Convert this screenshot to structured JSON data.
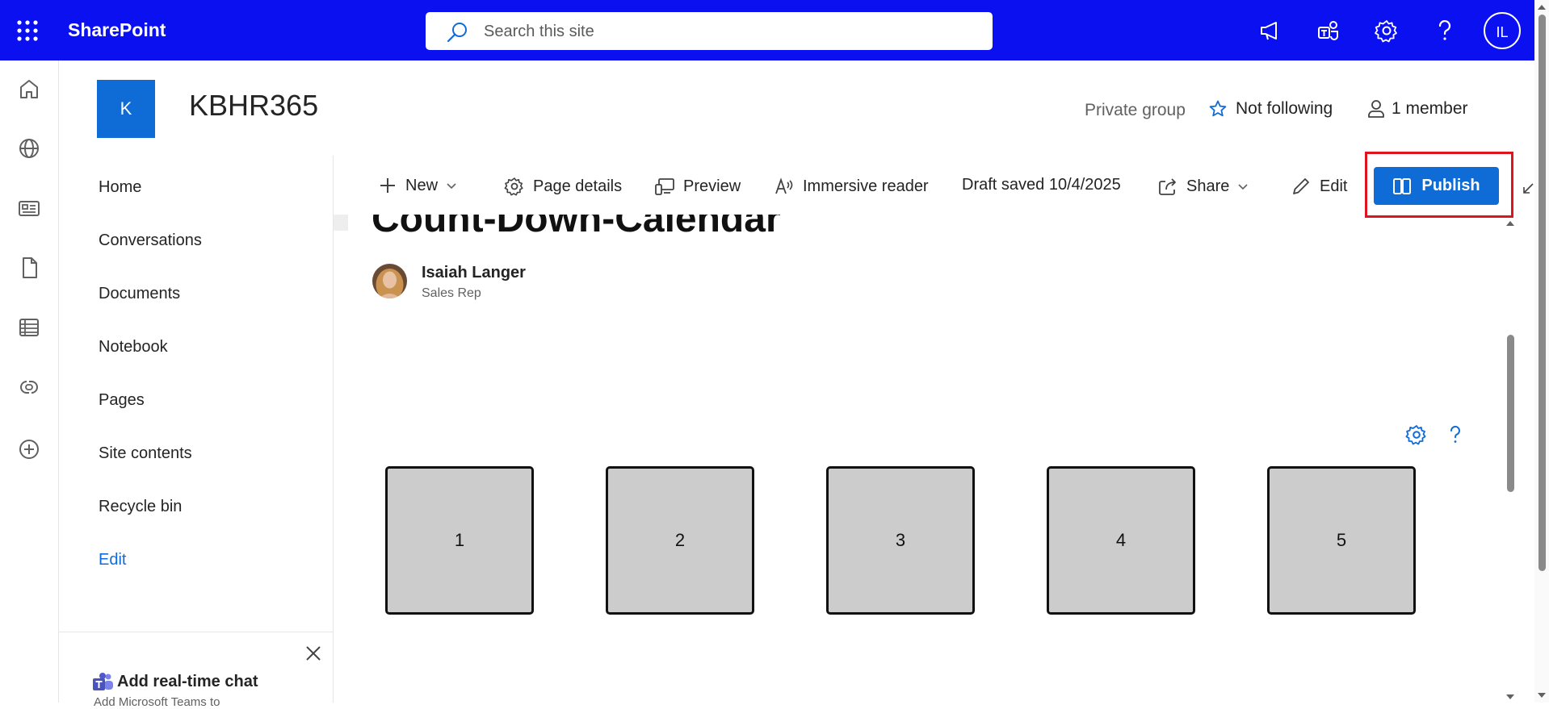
{
  "suite": {
    "brand": "SharePoint",
    "search_placeholder": "Search this site",
    "avatar_initials": "IL",
    "colors": {
      "bar": "#0a10f0",
      "accent": "#0f6cd6",
      "highlight": "#e0141e"
    }
  },
  "site": {
    "logo_letter": "K",
    "title": "KBHR365",
    "privacy": "Private group",
    "follow_label": "Not following",
    "members_label": "1 member"
  },
  "nav": {
    "items": [
      "Home",
      "Conversations",
      "Documents",
      "Notebook",
      "Pages",
      "Site contents",
      "Recycle bin"
    ],
    "edit_label": "Edit"
  },
  "chat": {
    "title": "Add real-time chat",
    "subtitle": "Add Microsoft Teams to"
  },
  "commandbar": {
    "new_label": "New",
    "page_details_label": "Page details",
    "preview_label": "Preview",
    "immersive_label": "Immersive reader",
    "draft_status": "Draft saved 10/4/2025",
    "share_label": "Share",
    "edit_label": "Edit",
    "publish_label": "Publish"
  },
  "page": {
    "title": "Count-Down-Calendar",
    "author_name": "Isaiah Langer",
    "author_role": "Sales Rep"
  },
  "calendar": {
    "days": [
      "1",
      "2",
      "3",
      "4",
      "5"
    ]
  }
}
